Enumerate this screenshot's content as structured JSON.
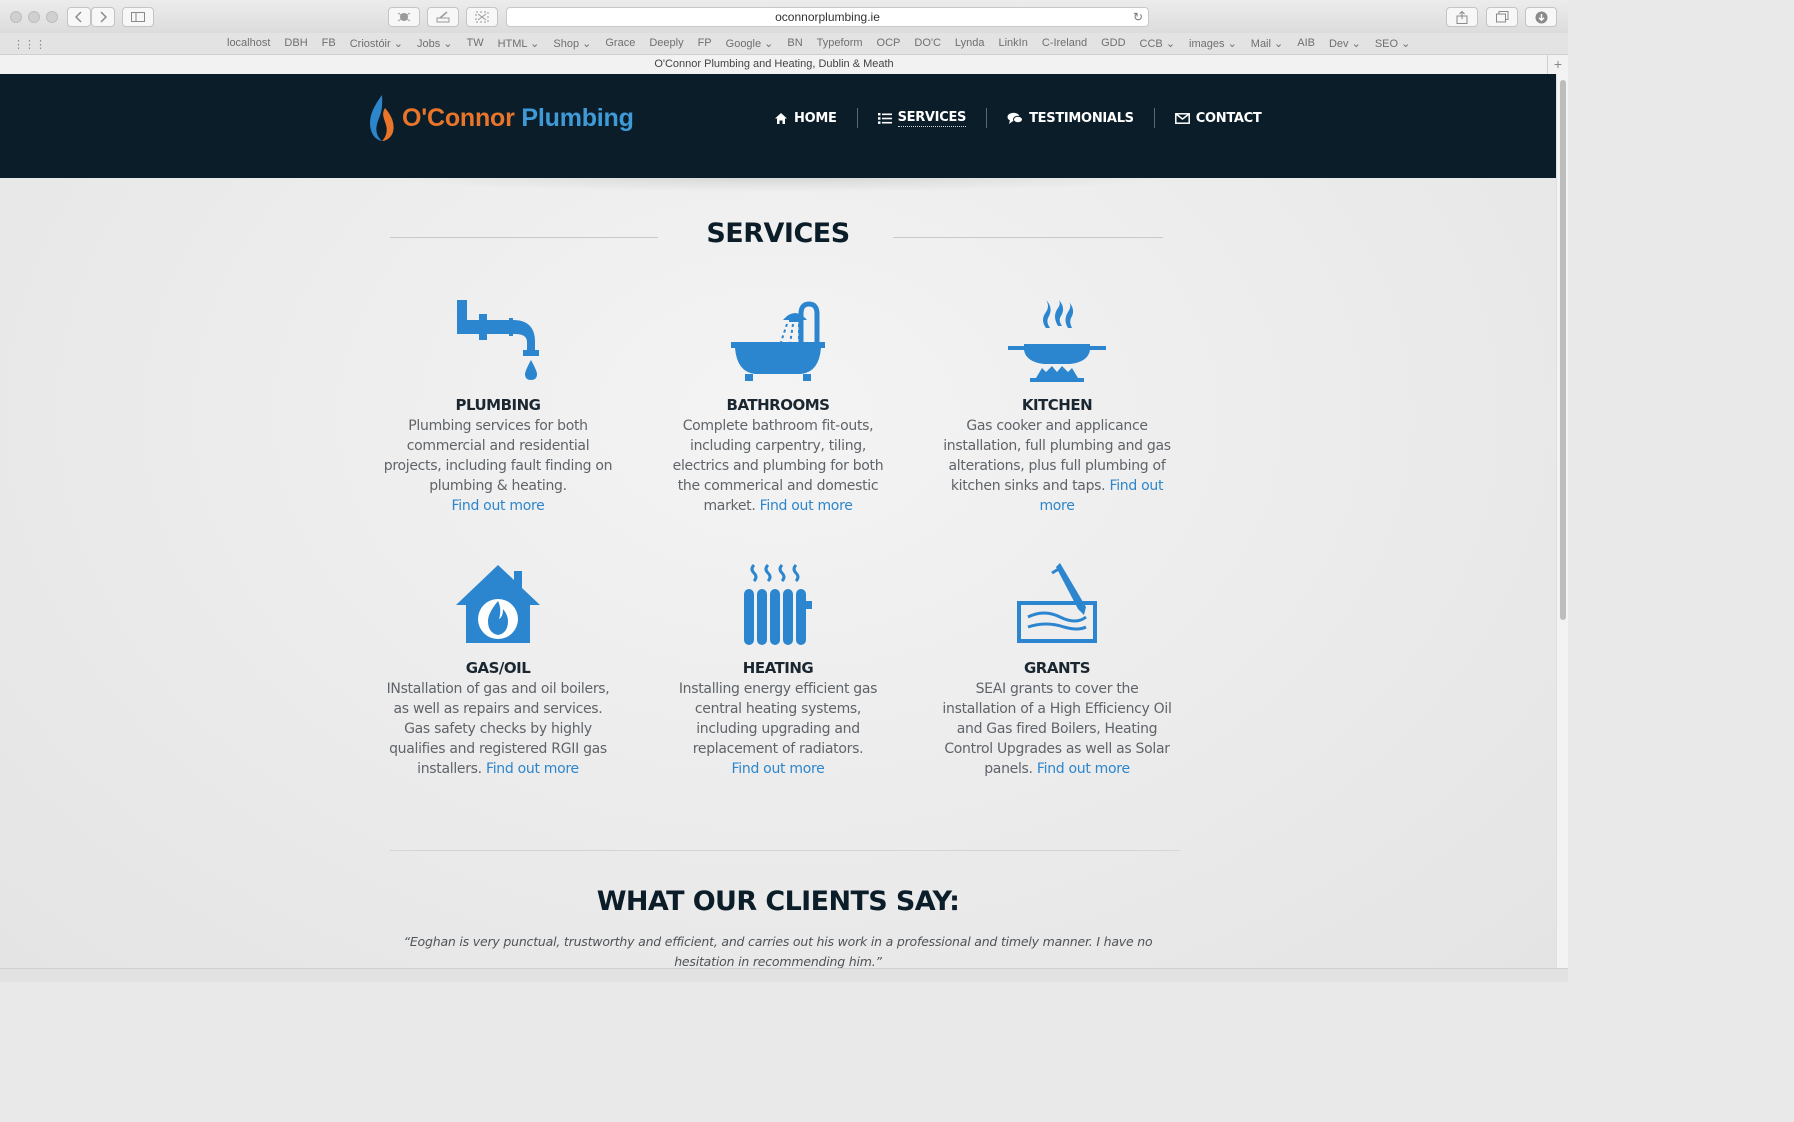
{
  "browser": {
    "url": "oconnorplumbing.ie",
    "tab_title": "O'Connor Plumbing and Heating, Dublin & Meath",
    "bookmarks": [
      "localhost",
      "DBH",
      "FB",
      "Criostóir ⌄",
      "Jobs ⌄",
      "TW",
      "HTML ⌄",
      "Shop ⌄",
      "Grace",
      "Deeply",
      "FP",
      "Google ⌄",
      "BN",
      "Typeform",
      "OCP",
      "DO'C",
      "Lynda",
      "LinkIn",
      "C-Ireland",
      "GDD",
      "CCB ⌄",
      "images ⌄",
      "Mail ⌄",
      "AIB",
      "Dev ⌄",
      "SEO ⌄"
    ]
  },
  "site": {
    "logo_part1": "O'Connor",
    "logo_part2": " Plumbing",
    "colors": {
      "header_bg": "#0b1d29",
      "accent_blue": "#2d86cc",
      "logo_orange": "#e8752a"
    },
    "nav": [
      {
        "label": "HOME",
        "icon": "home-icon"
      },
      {
        "label": "SERVICES",
        "icon": "list-icon",
        "active": true
      },
      {
        "label": "TESTIMONIALS",
        "icon": "chat-icon"
      },
      {
        "label": "CONTACT",
        "icon": "envelope-icon"
      }
    ]
  },
  "services_section": {
    "title": "SERVICES",
    "link_text": "Find out more",
    "items": [
      {
        "title": "PLUMBING",
        "icon": "faucet-pipe-icon",
        "text": "Plumbing services for both commercial and residential projects, including fault finding on plumbing & heating."
      },
      {
        "title": "BATHROOMS",
        "icon": "bathtub-shower-icon",
        "text": "Complete bathroom fit-outs, including carpentry, tiling, electrics and plumbing for both the commerical and domestic market."
      },
      {
        "title": "KITCHEN",
        "icon": "pan-on-gas-icon",
        "text": "Gas cooker and applicance installation, full plumbing and gas alterations, plus full plumbing of kitchen sinks and taps."
      },
      {
        "title": "GAS/OIL",
        "icon": "house-flame-icon",
        "text": "INstallation of gas and oil boilers, as well as repairs and services. Gas safety checks by highly qualifies and registered RGII gas installers."
      },
      {
        "title": "HEATING",
        "icon": "radiator-icon",
        "text": "Installing energy efficient gas central heating systems, including upgrading and replacement of radiators."
      },
      {
        "title": "GRANTS",
        "icon": "pen-signing-icon",
        "text": "SEAI grants to cover the installation of a High Efficiency Oil and Gas fired Boilers, Heating Control Upgrades as well as Solar panels."
      }
    ]
  },
  "clients_section": {
    "title": "WHAT OUR CLIENTS SAY:",
    "quote": "“Eoghan is very punctual, trustworthy and efficient, and carries out his work in a professional and timely manner. I have no hesitation in recommending him.”"
  }
}
